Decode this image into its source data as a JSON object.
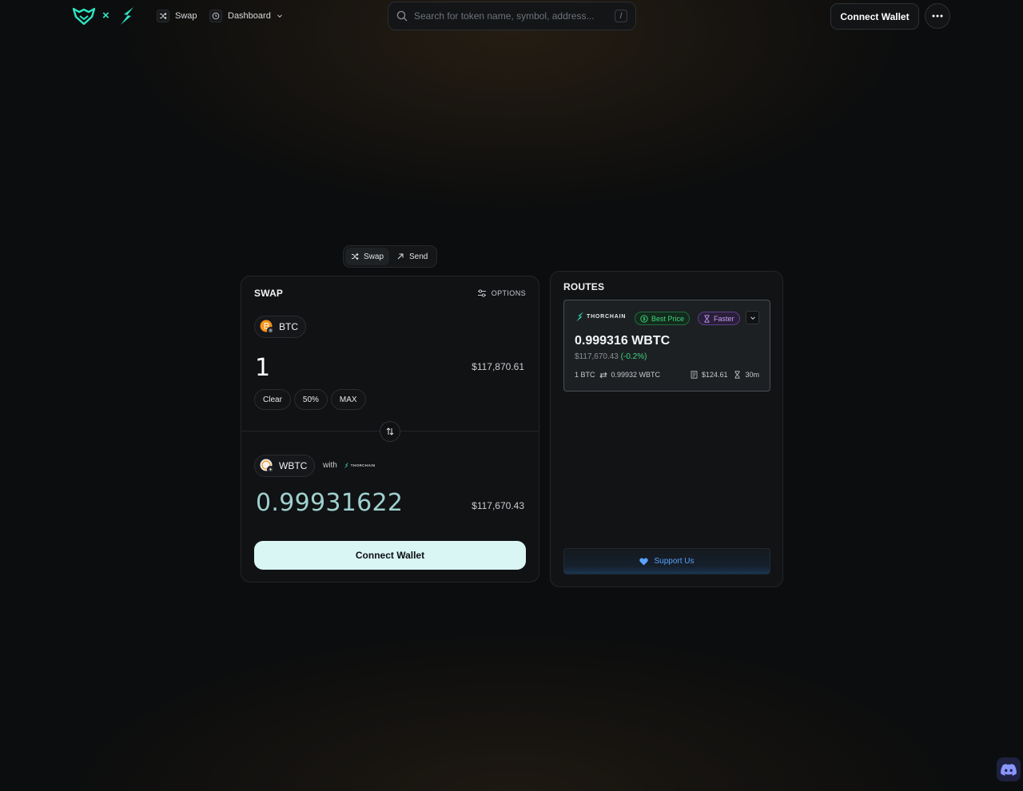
{
  "header": {
    "logo_separator": "×",
    "nav": [
      {
        "label": "Swap",
        "icon": "shuffle-icon"
      },
      {
        "label": "Dashboard",
        "icon": "clock-icon"
      }
    ],
    "search": {
      "placeholder": "Search for token name, symbol, address...",
      "shortcut": "/"
    },
    "connect_wallet": "Connect Wallet"
  },
  "mode_toggle": {
    "swap": "Swap",
    "send": "Send"
  },
  "swap_panel": {
    "title": "SWAP",
    "options": "OPTIONS",
    "from": {
      "token": "BTC",
      "amount": "1",
      "usd": "$117,870.61"
    },
    "quick_buttons": [
      "Clear",
      "50%",
      "MAX"
    ],
    "to": {
      "token": "WBTC",
      "with": "with",
      "provider": "THORCHAIN",
      "amount": "0.99931622",
      "usd": "$117,670.43"
    },
    "connect_wallet": "Connect Wallet"
  },
  "routes_panel": {
    "title": "ROUTES",
    "route": {
      "provider": "THORCHAIN",
      "badge_best": "Best Price",
      "badge_fast": "Faster",
      "amount": "0.999316 WBTC",
      "usd": "$117,670.43",
      "pct": "(-0.2%)",
      "rate_from": "1 BTC",
      "rate_to": "0.99932 WBTC",
      "fee": "$124.61",
      "time": "30m"
    },
    "support": "Support Us"
  },
  "colors": {
    "accent_teal": "#2ee6c5",
    "best_green": "#3fd67a",
    "faster_purple": "#c99bf0",
    "support_blue": "#5aa2ff",
    "btc_orange": "#f7931a"
  }
}
